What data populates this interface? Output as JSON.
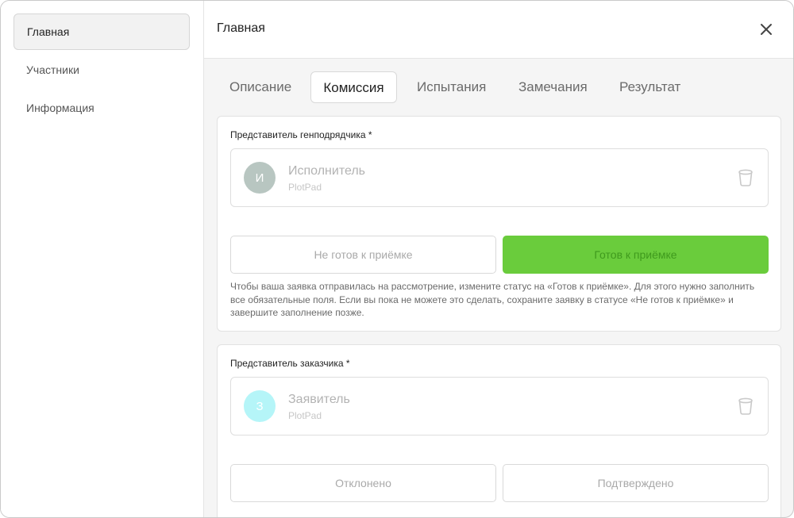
{
  "sidebar": {
    "items": [
      {
        "label": "Главная",
        "active": true
      },
      {
        "label": "Участники",
        "active": false
      },
      {
        "label": "Информация",
        "active": false
      }
    ]
  },
  "header": {
    "title": "Главная",
    "close_icon": "close-icon"
  },
  "tabs": [
    {
      "label": "Описание",
      "active": false
    },
    {
      "label": "Комиссия",
      "active": true
    },
    {
      "label": "Испытания",
      "active": false
    },
    {
      "label": "Замечания",
      "active": false
    },
    {
      "label": "Результат",
      "active": false
    }
  ],
  "contractor": {
    "label": "Представитель генподрядчика *",
    "avatar_letter": "И",
    "avatar_color": "#b8c6c1",
    "name": "Исполнитель",
    "org": "PlotPad",
    "not_ready_label": "Не готов к приёмке",
    "ready_label": "Готов к приёмке",
    "ready_color": "#6acc3c",
    "hint": "Чтобы ваша заявка отправилась на рассмотрение, измените статус на «Готов к приёмке». Для этого нужно заполнить все обязательные поля. Если вы пока не можете это сделать, сохраните заявку в статусе «Не готов к приёмке» и завершите заполнение позже."
  },
  "customer": {
    "label": "Представитель заказчика *",
    "avatar_letter": "З",
    "avatar_color": "#b5f5f8",
    "name": "Заявитель",
    "org": "PlotPad",
    "rejected_label": "Отклонено",
    "confirmed_label": "Подтверждено"
  }
}
